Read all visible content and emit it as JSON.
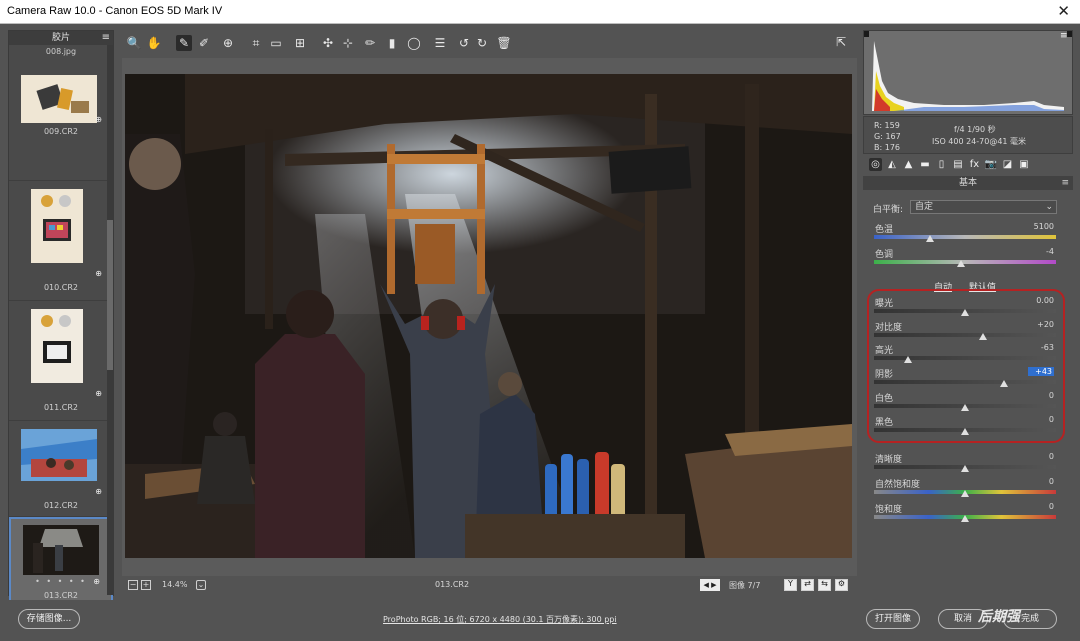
{
  "window": {
    "title": "Camera Raw 10.0 -  Canon EOS 5D Mark IV",
    "close_glyph": "✕"
  },
  "filmstrip": {
    "header": "胶片",
    "first_name": "008.jpg",
    "items": [
      {
        "name": "009.CR2",
        "flag": "⊕"
      },
      {
        "name": "010.CR2",
        "flag": "⊕"
      },
      {
        "name": "011.CR2",
        "flag": "⊕"
      },
      {
        "name": "012.CR2",
        "flag": "⊕"
      },
      {
        "name": "013.CR2",
        "flag": "⊕",
        "dots": "• • • • •"
      }
    ]
  },
  "toolbar": {
    "icons": [
      "zoom-icon",
      "hand-icon",
      "white-balance-icon",
      "color-sampler-icon",
      "target-adjust-icon",
      "crop-icon",
      "straighten-icon",
      "transform-icon",
      "spot-removal-icon",
      "red-eye-icon",
      "adjustment-brush-icon",
      "graduated-filter-icon",
      "radial-filter-icon",
      "presets-list-icon",
      "rotate-left-icon",
      "rotate-right-icon",
      "trash-icon"
    ],
    "glyphs": [
      "🔍",
      "✋",
      "✎",
      "✐",
      "⊕",
      "⌗",
      "▭",
      "⊞",
      "✣",
      "⊹",
      "✏",
      "▮",
      "◯",
      "☰",
      "↺",
      "↻",
      "🗑"
    ],
    "fullscreen_glyph": "⇱"
  },
  "preview": {
    "zoom_minus": "−",
    "zoom_plus": "+",
    "zoom": "14.4%",
    "zoom_arrow": "⌄",
    "filename": "013.CR2",
    "nav": "◀ ▶",
    "image_count": "图像 7/7",
    "icons": {
      "y": "Y",
      "compare": "⇄",
      "swap": "⇆",
      "settings": "⚙"
    }
  },
  "histogram": {
    "menu": "≡",
    "colors": {
      "white": "#f2f2f2",
      "yellow": "#e8d21e",
      "red": "#d23a2a",
      "blue": "#3b6cd0"
    }
  },
  "info": {
    "r": "R:  159",
    "g": "G:  167",
    "b": "B:  176",
    "aperture_shutter": "f/4   1/90 秒",
    "iso_lens": "ISO 400   24-70@41 毫米"
  },
  "panel": {
    "tabs": [
      "◎",
      "◭",
      "▲",
      "▬",
      "▯",
      "▤",
      "fx",
      "📷",
      "◪",
      "▣"
    ],
    "title": "基本",
    "menu": "≡",
    "white_balance_label": "白平衡:",
    "white_balance_value": "自定",
    "white_balance_arrow": "⌄",
    "auto_label": "自动",
    "default_label": "默认值",
    "sliders": [
      {
        "label": "色温",
        "value": "5100",
        "pos": 0.31,
        "track": "temp"
      },
      {
        "label": "色调",
        "value": "-4",
        "pos": 0.48,
        "track": "tint"
      },
      {
        "label": "曝光",
        "value": "0.00",
        "pos": 0.5,
        "track": "plain"
      },
      {
        "label": "对比度",
        "value": "+20",
        "pos": 0.6,
        "track": "plain"
      },
      {
        "label": "高光",
        "value": "-63",
        "pos": 0.185,
        "track": "plain"
      },
      {
        "label": "阴影",
        "value": "+43",
        "pos": 0.715,
        "track": "plain",
        "highlight": true
      },
      {
        "label": "白色",
        "value": "0",
        "pos": 0.5,
        "track": "plain"
      },
      {
        "label": "黑色",
        "value": "0",
        "pos": 0.5,
        "track": "plain"
      },
      {
        "label": "清晰度",
        "value": "0",
        "pos": 0.5,
        "track": "plain"
      },
      {
        "label": "自然饱和度",
        "value": "0",
        "pos": 0.5,
        "track": "spectrum"
      },
      {
        "label": "饱和度",
        "value": "0",
        "pos": 0.5,
        "track": "spectrum"
      }
    ]
  },
  "bottom": {
    "save_label": "存储图像...",
    "workflow_link": "ProPhoto RGB; 16 位; 6720 x 4480 (30.1 百万像素); 300 ppi",
    "open_label": "打开图像",
    "cancel_label": "取消",
    "done_label": "完成"
  },
  "watermark": "后期强",
  "accent": {
    "selection": "#5b89c7",
    "highlight_box": "#b52222",
    "value_highlight": "#2f6fcf"
  }
}
